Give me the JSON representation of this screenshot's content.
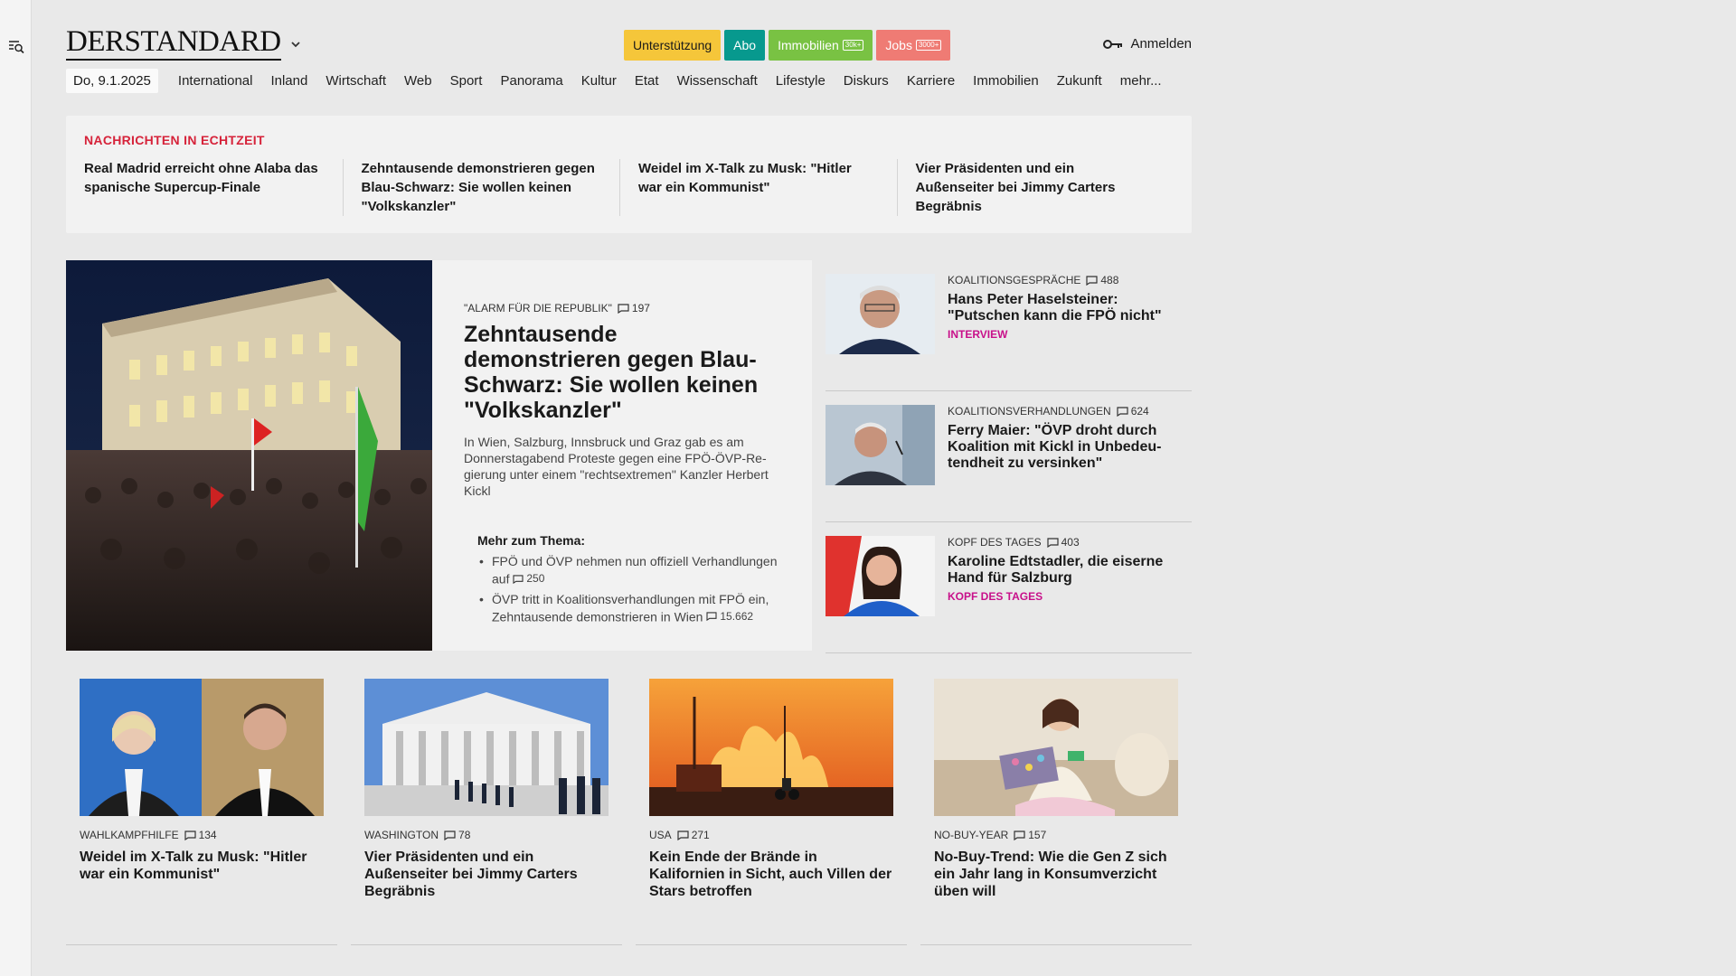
{
  "brand": {
    "logo": "DERSTANDARD"
  },
  "header": {
    "pills": [
      {
        "label": "Unterstützung",
        "count": ""
      },
      {
        "label": "Abo",
        "count": ""
      },
      {
        "label": "Immobilien",
        "count": "30k+"
      },
      {
        "label": "Jobs",
        "count": "3000+"
      }
    ],
    "login": "Anmelden"
  },
  "nav": {
    "date": "Do, 9.1.2025",
    "items": [
      "International",
      "Inland",
      "Wirtschaft",
      "Web",
      "Sport",
      "Panorama",
      "Kultur",
      "Etat",
      "Wissenschaft",
      "Lifestyle",
      "Diskurs",
      "Karriere",
      "Immobilien",
      "Zukunft",
      "mehr..."
    ]
  },
  "ticker": {
    "label": "NACHRICHTEN IN ECHTZEIT",
    "items": [
      "Real Madrid erreicht ohne Alaba das spanische Supercup-Finale",
      "Zehntausende demonstrieren gegen Blau-Schwarz: Sie wollen keinen \"Volkskanzler\"",
      "Weidel im X-Talk zu Musk: \"Hitler war ein Kommunist\"",
      "Vier Präsidenten und ein Außenseiter bei Jimmy Carters Begräbnis"
    ]
  },
  "lead": {
    "kicker": "\"Alarm für die Republik\"",
    "comments": "197",
    "title": "Zehntausende demonstrieren gegen Blau-Schwarz: Sie wollen keinen \"Volkskanzler\"",
    "teaser": "In Wien, Salzburg, Innsbruck und Graz gab es am Donnerstagabend Proteste gegen eine FPÖ-ÖVP-Re­gierung unter einem \"rechtsextremen\" Kanzler Herbert Kickl",
    "more_label": "Mehr zum Thema:",
    "more": [
      {
        "text": "FPÖ und ÖVP nehmen nun offiziell Verhandlungen auf",
        "comments": "250"
      },
      {
        "text": "ÖVP tritt in Koalitionsverhandlungen mit FPÖ ein, Zehntausende demonstrieren in Wien",
        "comments": "15.662"
      }
    ]
  },
  "side": [
    {
      "kicker": "Koalitionsgespräche",
      "comments": "488",
      "title": "Hans Peter Haselsteiner: \"Putschen kann die FPÖ nicht\"",
      "tag": "Interview"
    },
    {
      "kicker": "Koalitionsverhandlungen",
      "comments": "624",
      "title": "Ferry Maier: \"ÖVP droht durch Koalition mit Kickl in Unbedeu­tendheit zu versinken\"",
      "tag": ""
    },
    {
      "kicker": "Kopf des Tages",
      "comments": "403",
      "title": "Karoline Edtstadler, die eiserne Hand für Salzburg",
      "tag": "Kopf des Tages"
    }
  ],
  "bottom": [
    {
      "kicker": "Wahlkampfhilfe",
      "comments": "134",
      "title": "Weidel im X-Talk zu Musk: \"Hitler war ein Kommunist\""
    },
    {
      "kicker": "Washington",
      "comments": "78",
      "title": "Vier Präsidenten und ein Außenseiter bei Jimmy Carters Begräbnis"
    },
    {
      "kicker": "USA",
      "comments": "271",
      "title": "Kein Ende der Brände in Kalifornien in Sicht, auch Villen der Stars betroffen"
    },
    {
      "kicker": "No-Buy-Year",
      "comments": "157",
      "title": "No-Buy-Trend: Wie die Gen Z sich ein Jahr lang in Konsumverzicht üben will"
    }
  ],
  "colors": {
    "ticker_label": "#d6233a",
    "tag": "#c8108a",
    "abo": "#07998e",
    "support": "#f5c63a",
    "immo": "#79c243",
    "jobs": "#ef7b74"
  }
}
